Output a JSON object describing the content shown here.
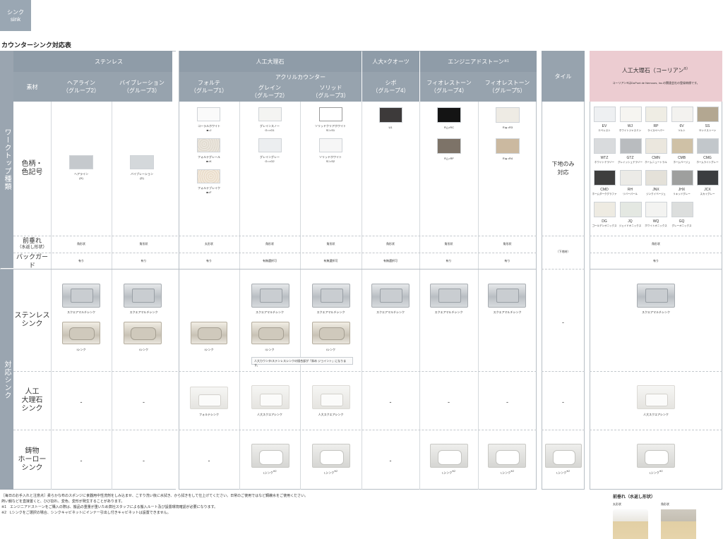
{
  "sink_tag": {
    "line1": "シンク",
    "line2": "sink"
  },
  "page_title": "カウンターシンク対応表",
  "headers": {
    "stainless": "ステンレス",
    "artificial_marble": "人工大理石",
    "acryl_counter": "アクリルカウンター",
    "quartz": "人大×クオーツ",
    "engineered_stone": "エンジニアドストーン",
    "engineered_stone_note": "※1",
    "tile": "タイル",
    "corian": "人工大理石（コーリアン",
    "corian_note": "®）",
    "corian_sub": "コーリアン®はDuPont de Nemours, Inc.の関連会社の登録商標です。",
    "material": "素材",
    "hairline": "ヘアライン\n（グループ2）",
    "vibration": "バイブレーション\n（グループ3）",
    "forte": "フォルテ\n（グループ1）",
    "grain": "グレイン\n（グループ2）",
    "solid": "ソリッド\n（グループ3）",
    "sibo": "シボ\n（グループ4）",
    "fiore4": "フィオレストーン\n（グループ4）",
    "fiore5": "フィオレストーン\n（グループ5）"
  },
  "side_labels": {
    "worktop_type": "ワークトップ種類",
    "sink_type": "対応シンク"
  },
  "row_labels": {
    "color": "色柄・\n色記号",
    "front_edge": "前垂れ",
    "front_edge_sub": "（水返し形状）",
    "backguard": "バックガード",
    "stainless_sink": "ステンレス\nシンク",
    "marble_sink": "人工\n大理石\nシンク",
    "enamel_sink": "鋳物\nホーロー\nシンク"
  },
  "swatches": {
    "hairline": "ヘアライン\n(H)",
    "vibration": "バイブレーション\n(D)",
    "forte": [
      "コーラルホワイト\n■=J",
      "フォルテグレール\n■=K",
      "フォルテブレイク\n■=F"
    ],
    "grain": [
      "グレインスノー\nG○=G1",
      "グレイングレー\nG○=G2"
    ],
    "solid": [
      "ソリッドクリアホワイト\nS□=S1",
      "ソリッドホワイト\nS□=S2"
    ],
    "sibo": "U1",
    "fiore4": [
      "R△=RC",
      "R△=RF"
    ],
    "fiore5": [
      "R▲=R3",
      "R▲=R4"
    ],
    "tile": "下地のみ\n対応",
    "corian": [
      {
        "code": "EV",
        "name": "エベレスト",
        "color": "#eef0f2"
      },
      {
        "code": "WJ",
        "name": "ホワイトジャスミン",
        "color": "#f6f5f1"
      },
      {
        "code": "RP",
        "name": "ライスペーパー",
        "color": "#efede4"
      },
      {
        "code": "6V",
        "name": "ソルト",
        "color": "#f3f2ef"
      },
      {
        "code": "SS",
        "name": "サンドストーン",
        "color": "#b3a791"
      },
      {
        "code": "WTZ",
        "name": "ホワイトテラゾー",
        "color": "#d9dbdd"
      },
      {
        "code": "GTZ",
        "name": "グレイッシュテラゾー",
        "color": "#b9bcbf"
      },
      {
        "code": "CMN",
        "name": "ホームニュートラル",
        "color": "#ebe7de"
      },
      {
        "code": "CMB",
        "name": "ホームベージュ",
        "color": "#cfc1a6"
      },
      {
        "code": "CMG",
        "name": "ホームライトグレー",
        "color": "#c2c7cb"
      },
      {
        "code": "CMD",
        "name": "ホームダークグラファ",
        "color": "#3e3e3e"
      },
      {
        "code": "RH",
        "name": "リバーパール",
        "color": "#ecebe7"
      },
      {
        "code": "JNX",
        "name": "ジンクイベージュ",
        "color": "#e4e1d9"
      },
      {
        "code": "JHX",
        "name": "リキッドグレー",
        "color": "#9e9f9e"
      },
      {
        "code": "JCX",
        "name": "スカイグレー",
        "color": "#3b3d40"
      },
      {
        "code": "DG",
        "name": "ゴールデンオニックス",
        "color": "#eeebe2"
      },
      {
        "code": "JQ",
        "name": "ジェイドオニックス",
        "color": "#e4e8e2"
      },
      {
        "code": "WQ",
        "name": "ホワイトオニックス",
        "color": "#f3f3f1"
      },
      {
        "code": "GQ",
        "name": "グレーオニックス",
        "color": "#dcdedd"
      }
    ]
  },
  "front_edge": {
    "kaku": "角形状",
    "maru": "丸形状",
    "tile": "（下地材）"
  },
  "backguard": {
    "yes": "有り",
    "select": "有無選択可"
  },
  "sinks": {
    "square_multi": "スクエアマルチシンク",
    "i_sink": "Iシンク",
    "forte_sink": "フォルテシンク",
    "marble_square": "人大スクエアシンク",
    "l_sink": "Lシンク",
    "l_sink_note": "※2",
    "dash": "-",
    "joint_note": "人大カウンタ/ステンレスシンクの接合部が「斜め ジョイント」になります。"
  },
  "footnotes": [
    "［毎日のお手入れと注意点］柔らかな布のスポンジに食器用中性洗剤をしみ込ませ、こすり洗い後に水拭き、から拭きをして仕上げてください。日常のご使用ではなど鋼鹸水をご使用ください。",
    "熱い鍋などを直接置くと、ひび割れ、変色、変形が発生することがあります。",
    "※1　エンジニアドストーンをご購入の際は、搬品の重量が重いため弊社スタッフによる搬入ルート及び設置環境確認が必要になります。",
    "※2　Lシンクをご選択の場合、シンクキャビネットにインナー引出し付きキャビネットは設置できません。"
  ],
  "edge_legend": {
    "title": "前垂れ（水返し形状）",
    "maru": "丸形状",
    "kaku": "角形状"
  }
}
